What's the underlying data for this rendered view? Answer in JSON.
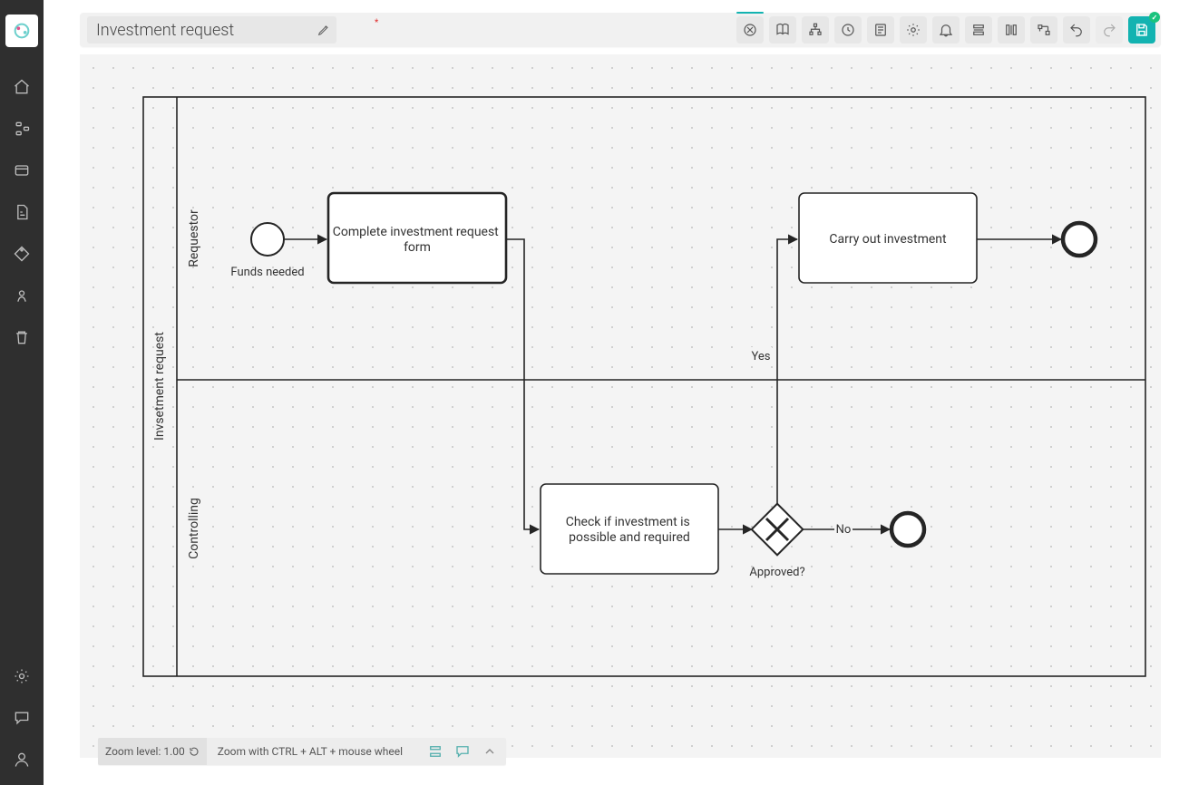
{
  "header": {
    "title": "Investment request",
    "dirty_marker": "*"
  },
  "diagram": {
    "pool_label": "Invsetment request",
    "lanes": {
      "top": "Requestor",
      "bottom": "Controlling"
    },
    "start_event_label": "Funds needed",
    "tasks": {
      "complete_form": "Complete investment request form",
      "carry_out": "Carry out investment",
      "check": "Check if investment is possible and required"
    },
    "gateway_label": "Approved?",
    "edge_labels": {
      "yes": "Yes",
      "no": "No"
    }
  },
  "statusbar": {
    "zoom_prefix": "Zoom level: ",
    "zoom_value": "1.00",
    "hint": "Zoom with CTRL + ALT + mouse wheel"
  }
}
